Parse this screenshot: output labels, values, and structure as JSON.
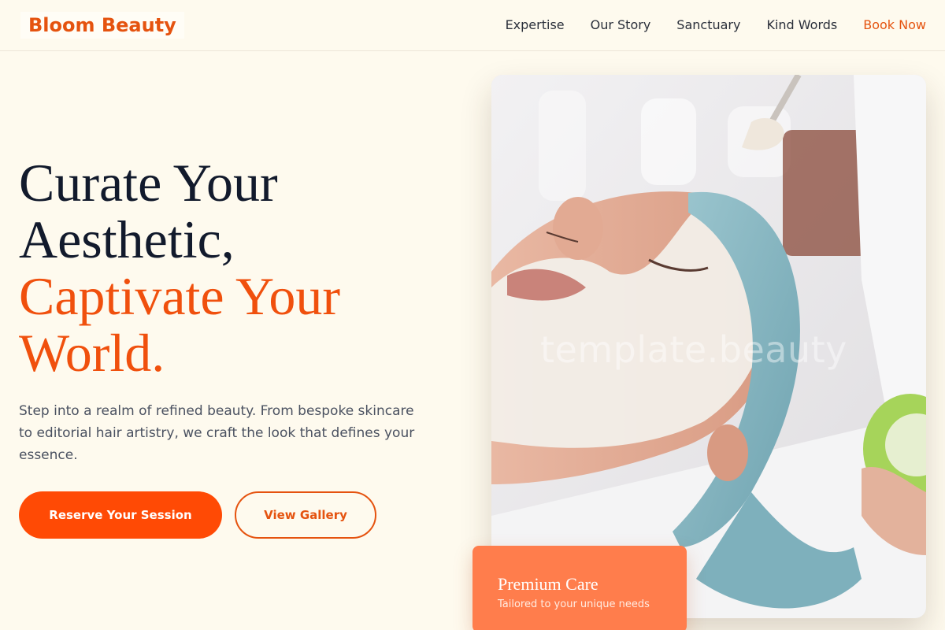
{
  "brand": {
    "name": "Bloom Beauty",
    "accent": "#e5530f",
    "primary_button": "#ff4a05",
    "badge": "#ff7d4c"
  },
  "nav": {
    "items": [
      {
        "label": "Expertise"
      },
      {
        "label": "Our Story"
      },
      {
        "label": "Sanctuary"
      },
      {
        "label": "Kind Words"
      },
      {
        "label": "Book Now"
      }
    ]
  },
  "hero": {
    "headline_line1": "Curate Your",
    "headline_line2": "Aesthetic,",
    "headline_accent_line1": "Captivate Your",
    "headline_accent_line2": "World.",
    "lead": "Step into a realm of refined beauty. From bespoke skincare to editorial hair artistry, we craft the look that defines your essence.",
    "primary_button": "Reserve Your Session",
    "secondary_button": "View Gallery"
  },
  "photo": {
    "watermark": "template.beauty"
  },
  "badge": {
    "title": "Premium Care",
    "subtitle": "Tailored to your unique needs"
  }
}
